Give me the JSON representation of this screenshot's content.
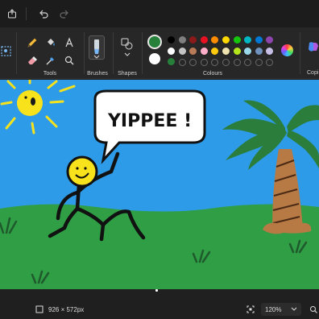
{
  "ribbon": {
    "tools_label": "Tools",
    "brushes_label": "Brushes",
    "shapes_label": "Shapes",
    "colours_label": "Colours",
    "copilot_label": "Copi"
  },
  "canvas": {
    "speech_text": "YIPPEE !"
  },
  "status": {
    "canvas_size": "926 × 572px",
    "zoom": "120%"
  },
  "colors": {
    "active": "#26803a",
    "secondary": "#ffffff",
    "palette_row1": [
      "#000000",
      "#7f7f7f",
      "#8b1a1a",
      "#e81123",
      "#ff8c00",
      "#ffd800",
      "#16c60c",
      "#00b7c3",
      "#0078d4",
      "#8e44ad"
    ],
    "palette_row2": [
      "#ffffff",
      "#c3c3c3",
      "#b97a57",
      "#ffaec9",
      "#ffc90e",
      "#efe4b0",
      "#b5e61d",
      "#99d9ea",
      "#7092be",
      "#c8bfe7"
    ]
  }
}
